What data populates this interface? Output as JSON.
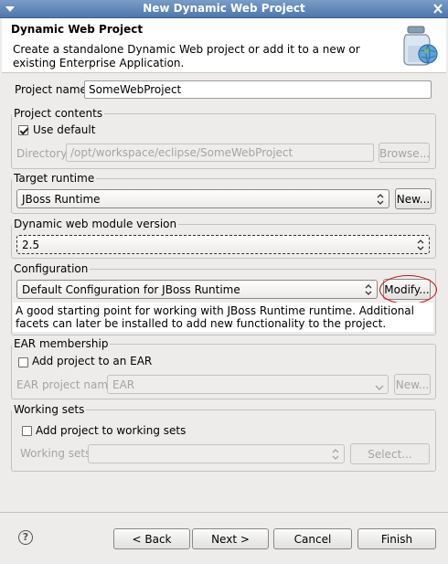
{
  "window": {
    "title": "New Dynamic Web Project"
  },
  "header": {
    "title": "Dynamic Web Project",
    "description": "Create a standalone Dynamic Web project or add it to a new or existing Enterprise Application."
  },
  "project_name": {
    "label": "Project name:",
    "value": "SomeWebProject"
  },
  "project_contents": {
    "legend": "Project contents",
    "use_default_label": "Use default",
    "use_default_checked": true,
    "directory_label": "Directory:",
    "directory_value": "/opt/workspace/eclipse/SomeWebProject",
    "browse_label": "Browse..."
  },
  "target_runtime": {
    "legend": "Target runtime",
    "selected": "JBoss Runtime",
    "new_label": "New..."
  },
  "module_version": {
    "legend": "Dynamic web module version",
    "selected": "2.5"
  },
  "configuration": {
    "legend": "Configuration",
    "selected": "Default Configuration for JBoss Runtime",
    "modify_label": "Modify...",
    "description": "A good starting point for working with JBoss Runtime runtime. Additional facets can later be installed to add new functionality to the project."
  },
  "ear": {
    "legend": "EAR membership",
    "add_label": "Add project to an EAR",
    "add_checked": false,
    "project_name_label": "EAR project name:",
    "project_name_value": "EAR",
    "new_label": "New..."
  },
  "working_sets": {
    "legend": "Working sets",
    "add_label": "Add project to working sets",
    "add_checked": false,
    "sets_label": "Working sets:",
    "sets_value": "",
    "select_label": "Select..."
  },
  "footer": {
    "back_label": "< Back",
    "next_label": "Next >",
    "cancel_label": "Cancel",
    "finish_label": "Finish"
  },
  "colors": {
    "titlebar": "#4f77ad",
    "highlight_ring": "#cc1010"
  }
}
